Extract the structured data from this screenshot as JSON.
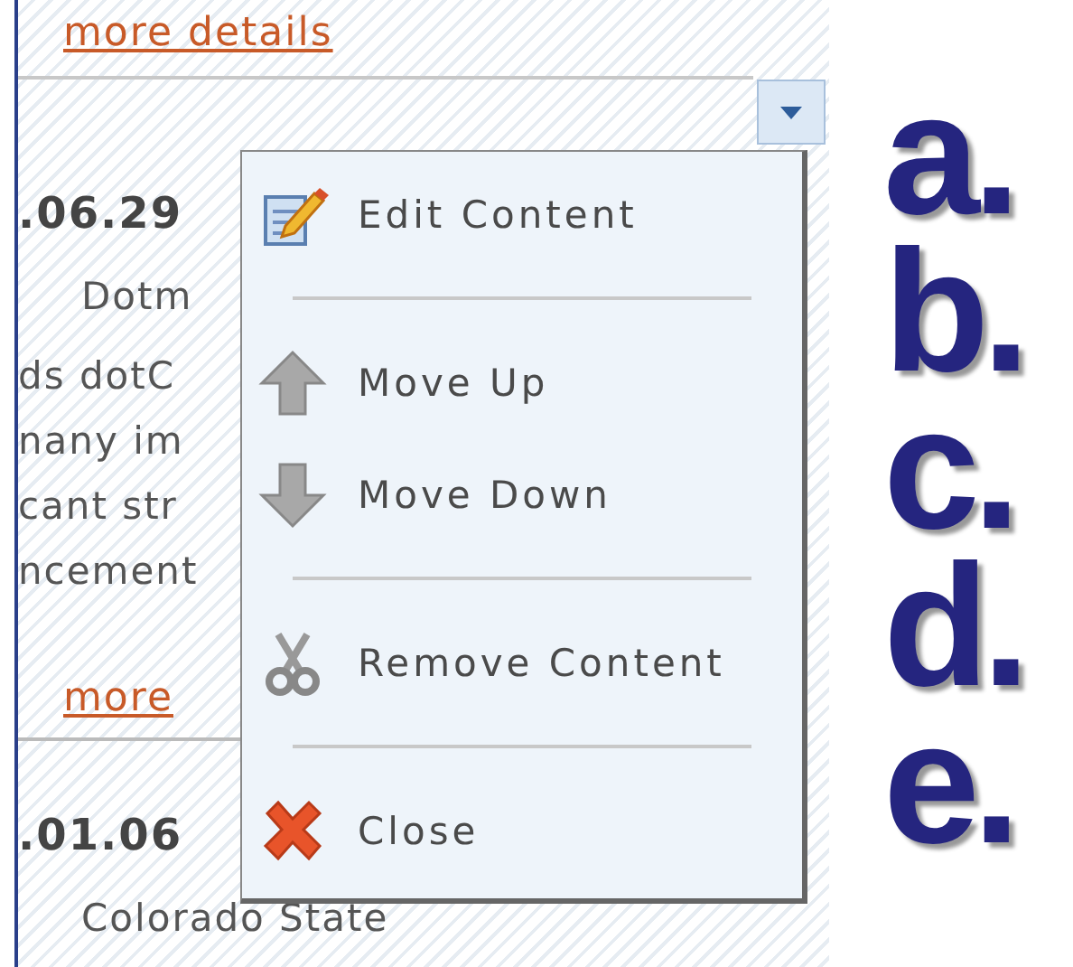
{
  "articles": [
    {
      "link": "more details"
    },
    {
      "date": ".06.29",
      "lines": [
        "Dotm",
        "ds dotC",
        "nany im",
        "cant str",
        "ncement"
      ],
      "link": "more"
    },
    {
      "date": ".01.06",
      "lines": [
        "Colorado State"
      ]
    }
  ],
  "context_menu": {
    "items": [
      {
        "kind": "item",
        "label": "Edit Content"
      },
      {
        "kind": "separator"
      },
      {
        "kind": "item",
        "label": "Move Up"
      },
      {
        "kind": "item",
        "label": "Move Down"
      },
      {
        "kind": "separator"
      },
      {
        "kind": "item",
        "label": "Remove Content"
      },
      {
        "kind": "separator"
      },
      {
        "kind": "item",
        "label": "Close"
      }
    ]
  },
  "callouts": [
    "a.",
    "b.",
    "c.",
    "d.",
    "e."
  ]
}
